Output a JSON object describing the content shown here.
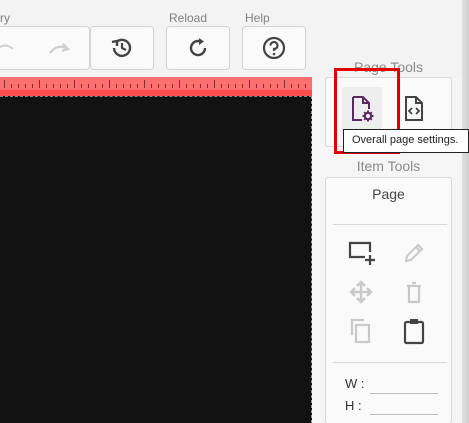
{
  "toolbar": {
    "history_label": "ry",
    "reload_label": "Reload",
    "help_label": "Help"
  },
  "page_tools": {
    "title": "Page Tools",
    "tooltip": "Overall page settings."
  },
  "item_tools": {
    "title": "Item Tools",
    "page_label": "Page",
    "width_label": "W :",
    "height_label": "H :"
  },
  "colors": {
    "highlight": "#e00000",
    "ruler": "#ff6f6f",
    "canvas": "#121212",
    "active_icon": "#5b2a63"
  }
}
